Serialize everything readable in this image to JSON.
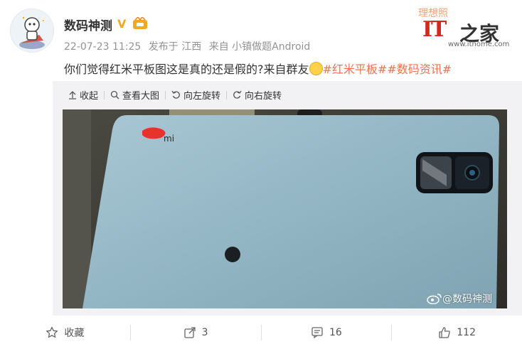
{
  "user": {
    "name": "数码神测",
    "verified_mark": "V"
  },
  "meta": {
    "time": "22-07-23 11:25",
    "location": "发布于 江西",
    "source": "来自 小镇做题Android"
  },
  "post": {
    "text": "你们觉得红米平板图这是真的还是假的?来自群友",
    "tag1": "#红米平板#",
    "tag2": "#数码资讯#",
    "emoji": "smile-emoji"
  },
  "watermark": {
    "text": "理想照",
    "it": "IT",
    "home": "之家",
    "url": "www.ithome.com"
  },
  "toolbar": {
    "collapse": "收起",
    "view_large": "查看大图",
    "rotate_left": "向左旋转",
    "rotate_right": "向右旋转"
  },
  "photo": {
    "brand_text": "mi",
    "watermark": "@数码神测"
  },
  "actions": {
    "favorite": "收藏",
    "repost_count": "3",
    "comment_count": "16",
    "like_count": "112"
  },
  "colors": {
    "tag": "#eb7350",
    "verified": "#f5a623",
    "tablet": "#8fb3c2"
  }
}
